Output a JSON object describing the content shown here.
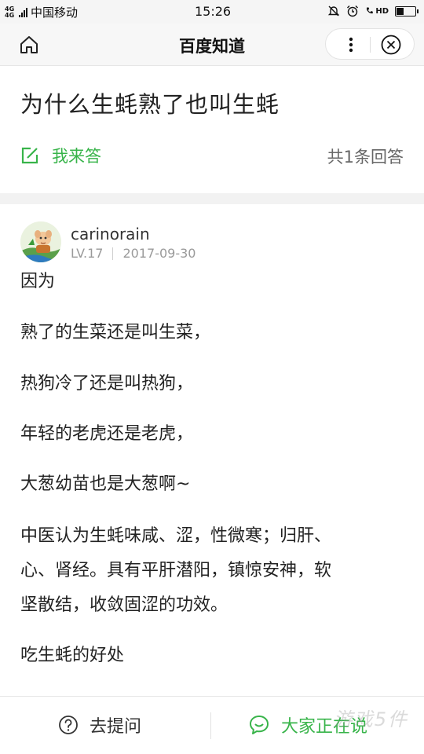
{
  "status_bar": {
    "network": "4G 4G",
    "carrier": "中国移动",
    "time": "15:26",
    "hd": "HD",
    "battery_level": 0.4
  },
  "nav": {
    "title": "百度知道"
  },
  "question": {
    "title": "为什么生蚝熟了也叫生蚝",
    "answer_action": "我来答",
    "answer_count": "共1条回答"
  },
  "answer": {
    "username": "carinorain",
    "level": "LV.17",
    "date": "2017-09-30",
    "lines": [
      "因为",
      "熟了的生菜还是叫生菜，",
      "热狗冷了还是叫热狗，",
      "年轻的老虎还是老虎，",
      "大葱幼苗也是大葱啊~",
      "中医认为生蚝味咸、涩，性微寒；归肝、",
      "心、肾经。具有平肝潜阳，镇惊安神，软",
      "坚散结，收敛固涩的功效。",
      "吃生蚝的好处"
    ]
  },
  "bottom_bar": {
    "ask_label": "去提问",
    "chat_label": "大家正在说"
  },
  "watermark": "游戏5件",
  "colors": {
    "accent_green": "#38b44a",
    "text_primary": "#222222",
    "text_secondary": "#666666",
    "meta_gray": "#9a9a9a"
  }
}
